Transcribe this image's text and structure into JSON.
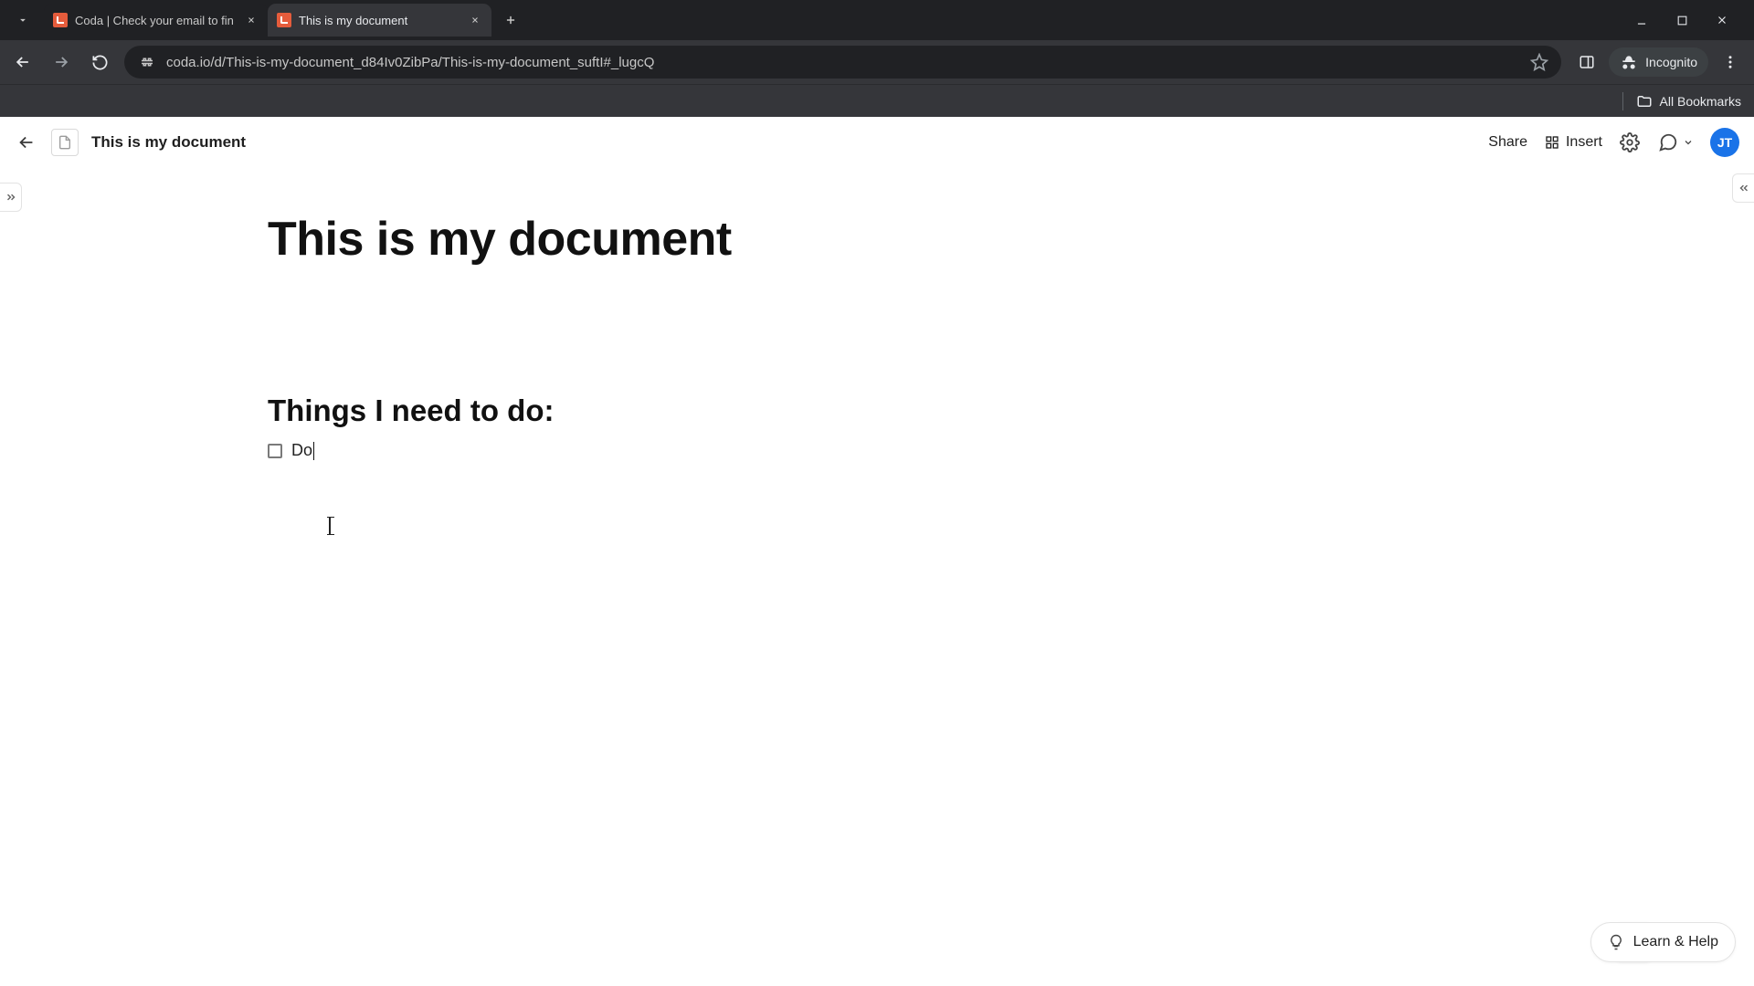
{
  "browser": {
    "tabs": [
      {
        "title": "Coda | Check your email to fin",
        "active": false
      },
      {
        "title": "This is my document",
        "active": true
      }
    ],
    "url": "coda.io/d/This-is-my-document_d84Iv0ZibPa/This-is-my-document_suftI#_lugcQ",
    "incognito_label": "Incognito",
    "all_bookmarks_label": "All Bookmarks"
  },
  "app_header": {
    "doc_title": "This is my document",
    "share_label": "Share",
    "insert_label": "Insert",
    "avatar_initials": "JT"
  },
  "document": {
    "h1": "This is my document",
    "h2": "Things I need to do:",
    "checklist": [
      {
        "checked": false,
        "text": "Do"
      }
    ]
  },
  "footer": {
    "learn_help_label": "Learn & Help"
  },
  "colors": {
    "avatar_bg": "#1a73e8",
    "coda_orange": "#e55c3c",
    "ai_blue": "#3d6bff"
  }
}
